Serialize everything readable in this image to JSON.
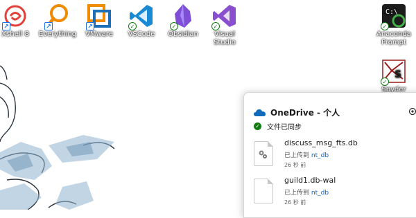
{
  "desktop": {
    "icons": [
      {
        "label": "Xshell 8",
        "icon": "xshell-icon",
        "badge": "shortcut"
      },
      {
        "label": "Everything",
        "icon": "everything-icon",
        "badge": "shortcut"
      },
      {
        "label": "VMware",
        "icon": "vmware-icon",
        "badge": "shortcut"
      },
      {
        "label": "VSCode",
        "icon": "vscode-icon",
        "badge": "synced"
      },
      {
        "label": "Obsidian",
        "icon": "obsidian-icon",
        "badge": "synced"
      },
      {
        "label": "Visual Studio",
        "icon": "visual-studio-icon",
        "badge": "synced"
      },
      {
        "label": "Anaconda Prompt",
        "icon": "anaconda-prompt-icon",
        "badge": "synced"
      },
      {
        "label": "Spyder",
        "icon": "spyder-icon",
        "badge": "synced"
      }
    ]
  },
  "onedrive": {
    "title": "OneDrive - 个人",
    "status": "文件已同步",
    "files": [
      {
        "name": "discuss_msg_fts.db",
        "uploaded_prefix": "已上传到",
        "folder": "nt_db",
        "time": "26 秒 前"
      },
      {
        "name": "guild1.db-wal",
        "uploaded_prefix": "已上传到",
        "folder": "nt_db",
        "time": "26 秒 前"
      }
    ]
  },
  "colors": {
    "onedrive_blue": "#0f6cbd",
    "sync_green": "#107c10",
    "link_blue": "#0a62c7"
  }
}
